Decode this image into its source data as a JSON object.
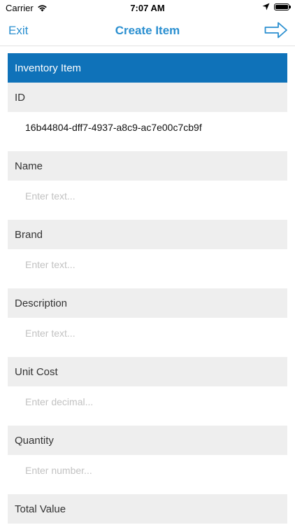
{
  "status_bar": {
    "carrier": "Carrier",
    "time": "7:07 AM"
  },
  "nav": {
    "exit_label": "Exit",
    "title": "Create Item",
    "accent_color": "#2a8fd0"
  },
  "form": {
    "header": "Inventory Item",
    "header_color": "#0f72b9",
    "fields": [
      {
        "label": "ID",
        "value": "16b44804-dff7-4937-a8c9-ac7e00c7cb9f"
      },
      {
        "label": "Name",
        "placeholder": "Enter text..."
      },
      {
        "label": "Brand",
        "placeholder": "Enter text..."
      },
      {
        "label": "Description",
        "placeholder": "Enter text..."
      },
      {
        "label": "Unit Cost",
        "placeholder": "Enter decimal..."
      },
      {
        "label": "Quantity",
        "placeholder": "Enter number..."
      },
      {
        "label": "Total Value"
      }
    ]
  }
}
